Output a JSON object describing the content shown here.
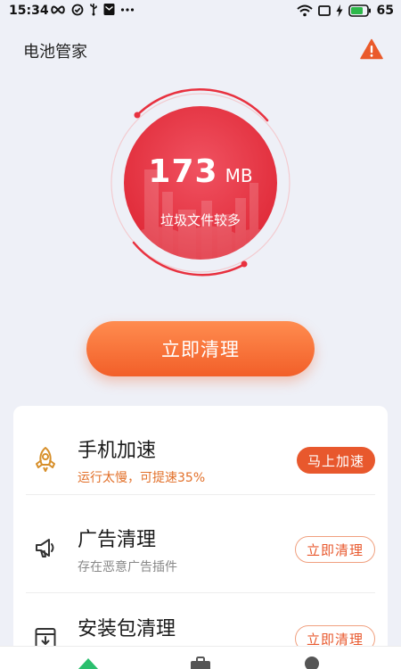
{
  "status_bar": {
    "time": "15:34",
    "battery_level": "65"
  },
  "header": {
    "title": "电池管家"
  },
  "gauge": {
    "value": "173",
    "unit": "MB",
    "caption": "垃圾文件较多",
    "accent_color": "#e8313f"
  },
  "primary_action": {
    "label": "立即清理"
  },
  "features": [
    {
      "icon": "rocket-icon",
      "title": "手机加速",
      "subtitle": "运行太慢，可提速35%",
      "button": "马上加速"
    },
    {
      "icon": "megaphone-icon",
      "title": "广告清理",
      "subtitle": "存在恶意广告插件",
      "button": "立即清理"
    },
    {
      "icon": "package-icon",
      "title": "安装包清理",
      "subtitle": "",
      "button": "立即清理"
    }
  ],
  "bottom_nav": {
    "items": [
      "home-icon",
      "toolbox-icon",
      "profile-icon"
    ]
  },
  "colors": {
    "accent": "#e8582d",
    "alert_text": "#e2702a",
    "background": "#eef0f7",
    "nav_active": "#2bbf6e"
  }
}
